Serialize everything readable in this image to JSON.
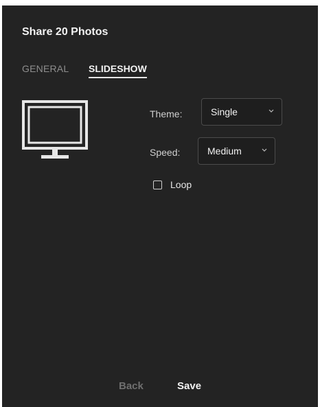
{
  "dialog": {
    "title": "Share 20 Photos"
  },
  "tabs": [
    {
      "label": "GENERAL",
      "active": false
    },
    {
      "label": "SLIDESHOW",
      "active": true
    }
  ],
  "preview": {
    "icon": "monitor-icon"
  },
  "settings": {
    "theme": {
      "label": "Theme:",
      "value": "Single"
    },
    "speed": {
      "label": "Speed:",
      "value": "Medium"
    },
    "loop": {
      "label": "Loop",
      "checked": false
    }
  },
  "footer": {
    "back_label": "Back",
    "save_label": "Save"
  },
  "colors": {
    "panel_background": "#232323",
    "text_primary": "#f2f2f2",
    "text_muted": "#8e8e8e",
    "button_disabled": "#6f6f6f"
  }
}
